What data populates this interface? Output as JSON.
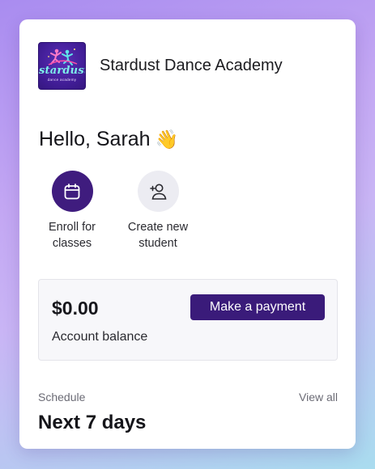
{
  "header": {
    "logo_word": "stardust",
    "logo_sub": "dance academy",
    "academy_name": "Stardust Dance Academy"
  },
  "greeting": {
    "text": "Hello, Sarah",
    "emoji": "👋"
  },
  "actions": [
    {
      "icon": "calendar-icon",
      "label_line1": "Enroll for",
      "label_line2": "classes"
    },
    {
      "icon": "add-user-icon",
      "label_line1": "Create new",
      "label_line2": "student"
    }
  ],
  "balance": {
    "amount": "$0.00",
    "label": "Account balance",
    "pay_button_label": "Make a payment"
  },
  "schedule": {
    "section_label": "Schedule",
    "view_all_label": "View all",
    "heading": "Next 7 days"
  },
  "colors": {
    "brand_purple": "#3a1b7a",
    "logo_accent": "#7df0ea",
    "icon_bg_light": "#ececf2"
  }
}
